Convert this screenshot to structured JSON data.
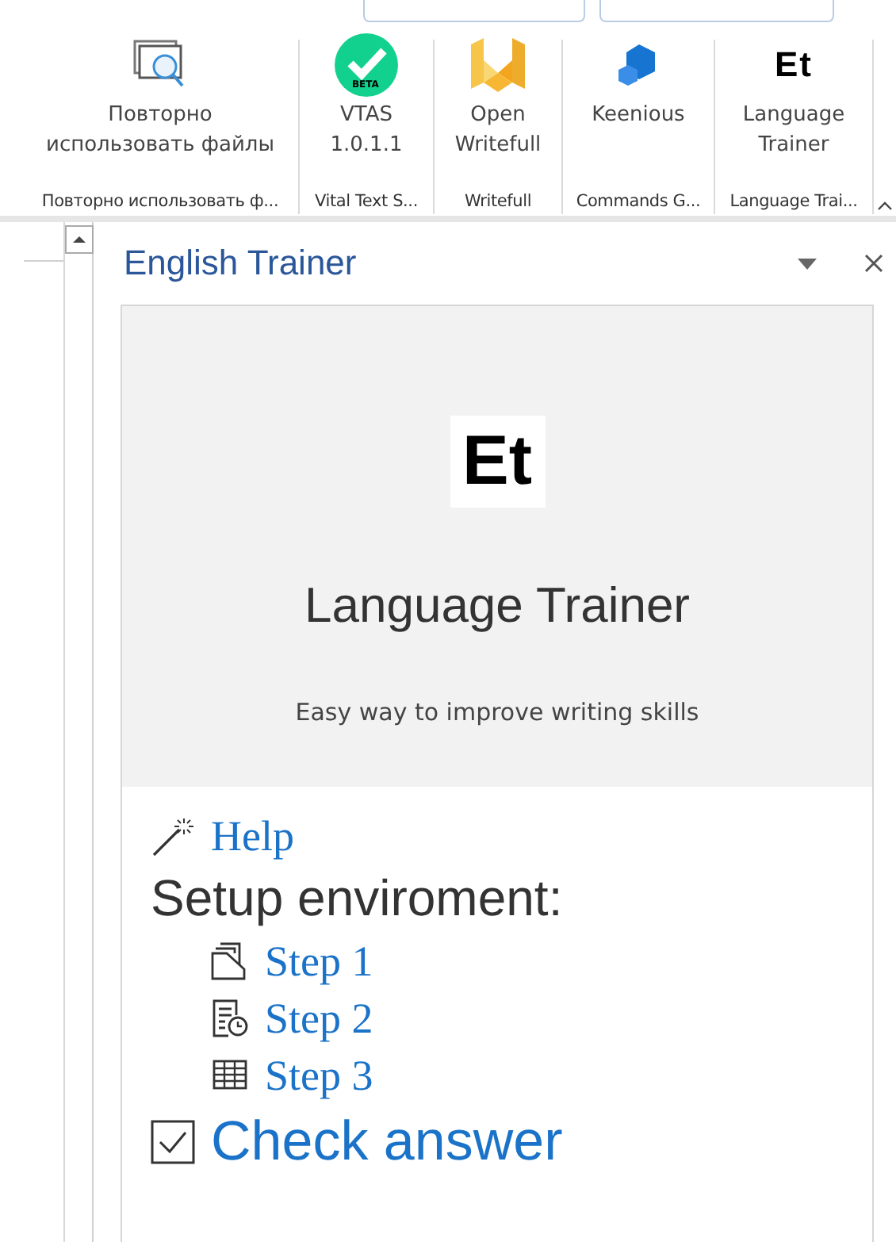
{
  "ribbon": {
    "groups": [
      {
        "label": "Повторно использовать ф...",
        "button": {
          "kind": "reuse",
          "lines": [
            "Повторно",
            "использовать файлы"
          ]
        }
      },
      {
        "label": "Vital Text S...",
        "button": {
          "kind": "vtas",
          "badge": "BETA",
          "lines": [
            "VTAS",
            "1.0.1.1"
          ]
        }
      },
      {
        "label": "Writefull",
        "button": {
          "kind": "writefull",
          "lines": [
            "Open",
            "Writefull"
          ]
        }
      },
      {
        "label": "Commands G...",
        "button": {
          "kind": "keenious",
          "lines": [
            "Keenious"
          ]
        }
      },
      {
        "label": "Language Trai...",
        "button": {
          "kind": "et",
          "logo": "Et",
          "lines": [
            "Language",
            "Trainer"
          ]
        }
      }
    ]
  },
  "pane": {
    "title": "English Trainer",
    "hero": {
      "logo": "Et",
      "title": "Language Trainer",
      "subtitle": "Easy way to improve writing skills"
    },
    "help": "Help",
    "setup_heading": "Setup enviroment:",
    "steps": [
      {
        "kind": "folder",
        "label": "Step 1"
      },
      {
        "kind": "schedule",
        "label": "Step 2"
      },
      {
        "kind": "table",
        "label": "Step 3"
      }
    ],
    "check": "Check answer"
  }
}
